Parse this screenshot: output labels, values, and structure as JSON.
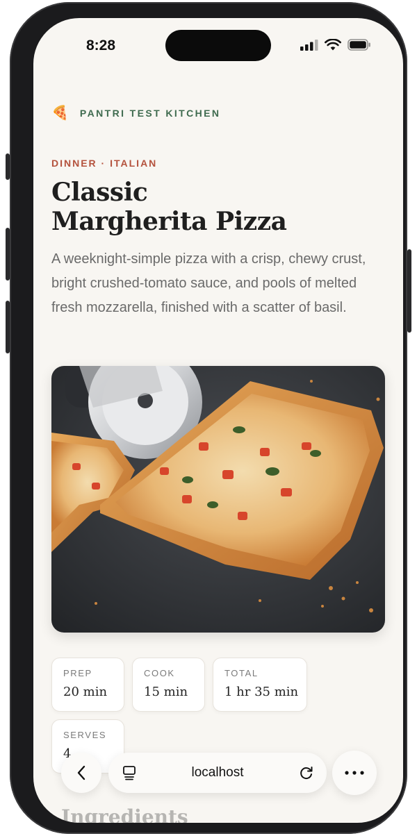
{
  "status_bar": {
    "time": "8:28"
  },
  "brand": {
    "emoji": "🍕",
    "name": "PANTRI TEST KITCHEN"
  },
  "recipe": {
    "category": "DINNER · ITALIAN",
    "title_line1": "Classic",
    "title_line2": "Margherita Pizza",
    "description": "A weeknight-simple pizza with a crisp, chewy crust, bright crushed-tomato sauce, and pools of melted fresh mozzarella, finished with a scatter of basil."
  },
  "stats": [
    {
      "label": "PREP",
      "value": "20 min"
    },
    {
      "label": "COOK",
      "value": "15 min"
    },
    {
      "label": "TOTAL",
      "value": "1 hr 35 min"
    },
    {
      "label": "SERVES",
      "value": "4"
    }
  ],
  "next_section_heading": "Ingredients",
  "browser": {
    "url": "localhost"
  },
  "icons": {
    "back": "chevron-left-icon",
    "tabs": "tabs-icon",
    "reload": "reload-icon",
    "more": "more-icon"
  }
}
